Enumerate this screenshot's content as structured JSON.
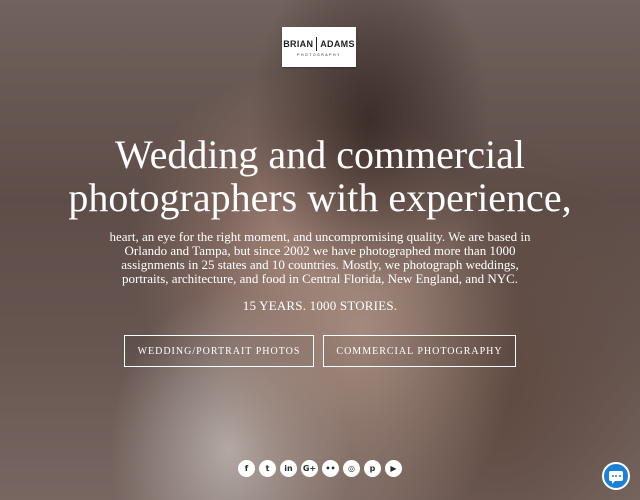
{
  "logo": {
    "left_text": "BRIAN",
    "right_text": "ADAMS",
    "subtext": "PHOTOGRAPHY"
  },
  "hero": {
    "headline_line1": "Wedding and commercial",
    "headline_line2": "photographers with experience,",
    "description": "heart, an eye for the right moment, and uncompromising quality. We are based in Orlando and Tampa, but since 2002 we have photographed more than 1000 assignments in 25 states and 10 countries. Mostly, we photograph weddings, portraits, architecture, and food in Central Florida, New England, and NYC.",
    "tagline": "15 YEARS. 1000 STORIES."
  },
  "buttons": {
    "wedding": "WEDDING/PORTRAIT PHOTOS",
    "commercial": "COMMERCIAL PHOTOGRAPHY"
  },
  "social": [
    {
      "name": "facebook-icon",
      "glyph": "f"
    },
    {
      "name": "twitter-icon",
      "glyph": "t"
    },
    {
      "name": "linkedin-icon",
      "glyph": "in"
    },
    {
      "name": "google-plus-icon",
      "glyph": "G+"
    },
    {
      "name": "flickr-icon",
      "glyph": "••"
    },
    {
      "name": "instagram-icon",
      "glyph": "◎"
    },
    {
      "name": "pinterest-icon",
      "glyph": "p"
    },
    {
      "name": "youtube-icon",
      "glyph": "▶"
    }
  ],
  "chat": {
    "icon": "chat-icon",
    "color": "#1e7fd6"
  }
}
